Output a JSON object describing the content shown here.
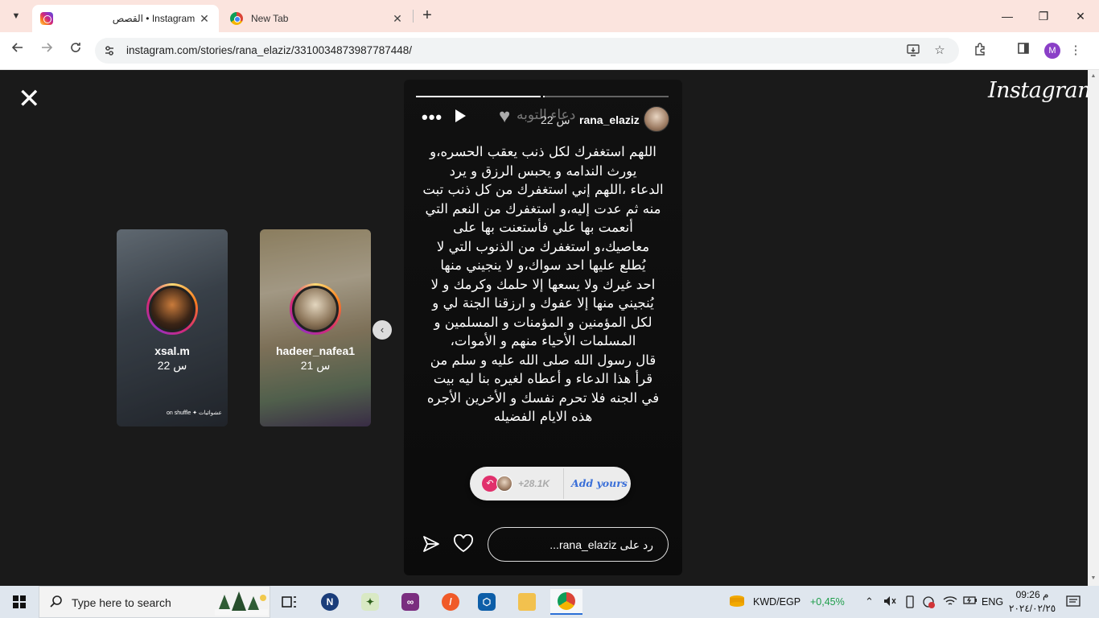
{
  "browser": {
    "tabs": [
      {
        "title": "القصص • Instagram",
        "close": "✕",
        "active": true
      },
      {
        "title": "New Tab",
        "close": "✕",
        "active": false
      }
    ],
    "new_tab": "+",
    "window_controls": {
      "minimize": "—",
      "maximize": "❐",
      "close": "✕"
    },
    "url": "instagram.com/stories/rana_elaziz/3310034873987787448/",
    "profile_initial": "M"
  },
  "page": {
    "logo": "Instagram",
    "close": "✕",
    "previews": [
      {
        "username": "xsal.m",
        "time": "22 س",
        "sticker": "on shuffle ✦ عشوائيات"
      },
      {
        "username": "hadeer_nafea1",
        "time": "21 س",
        "sticker": ""
      }
    ],
    "next_arrow": "‹",
    "story": {
      "username": "rana_elaziz",
      "time": "22 س",
      "music": "دعاء التوبه",
      "text": "اللهم استغفرك لكل ذنب يعقب الحسره،و\nيورث الندامه و يحبس الرزق و يرد\nالدعاء ،اللهم إني استغفرك من كل ذنب تبت\nمنه ثم عدت إليه،و استغفرك من النعم التي\nأنعمت بها علي فأستعنت بها على\nمعاصيك،و استغفرك من الذنوب التي لا\nيُطلع عليها احد سواك،و لا ينجيني منها\nاحد غيرك ولا يسعها إلا حلمك وكرمك و لا\nيُنجيني منها إلا عفوك و ارزقنا الجنة لي و\nلكل المؤمنين و المؤمنات و المسلمين و\nالمسلمات الأحياء منهم و الأموات،\nقال رسول الله صلى الله عليه و سلم من\nقرأ هذا الدعاء و أعطاه لغيره بنا ليه بيت\nفي الجنه فلا تحرم نفسك و الأخرين الأجره\nهذه الايام الفضيله",
      "add_yours_count": "+28.1K",
      "add_yours_label": "Add yours",
      "reply_placeholder": "رد على rana_elaziz..."
    }
  },
  "taskbar": {
    "search_placeholder": "Type here to search",
    "currency": "KWD/EGP",
    "currency_change": "+0,45%",
    "language": "ENG",
    "time": "09:26 م",
    "date": "٢٠٢٤/٠٢/٢٥"
  },
  "colors": {
    "tabstrip": "#fbe4de",
    "page_bg": "#1a1a1a",
    "taskbar": "#dfe6ee",
    "positive_change": "#1e9e4a",
    "add_yours_link": "#3a6fd8"
  }
}
